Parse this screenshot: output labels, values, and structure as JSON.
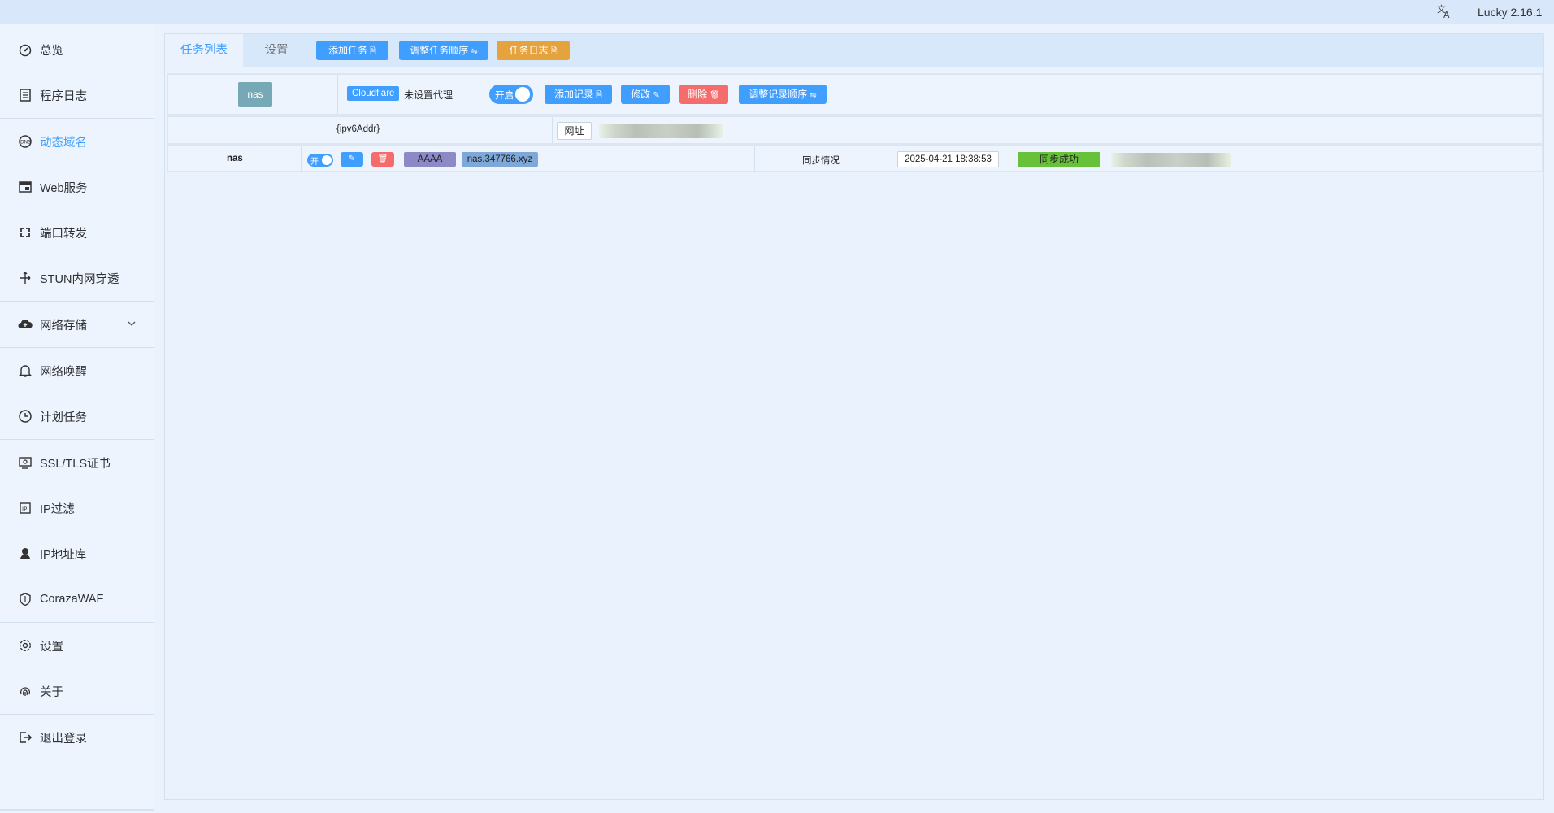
{
  "header": {
    "language_icon": "translate-icon",
    "version": "Lucky 2.16.1"
  },
  "sidebar": {
    "items": [
      {
        "label": "总览",
        "icon": "dashboard-icon"
      },
      {
        "label": "程序日志",
        "icon": "log-icon"
      },
      {
        "label": "动态域名",
        "icon": "dns-icon"
      },
      {
        "label": "Web服务",
        "icon": "web-service-icon"
      },
      {
        "label": "端口转发",
        "icon": "port-forward-icon"
      },
      {
        "label": "STUN内网穿透",
        "icon": "stun-icon"
      },
      {
        "label": "网络存储",
        "icon": "cloud-storage-icon"
      },
      {
        "label": "网络唤醒",
        "icon": "bell-icon"
      },
      {
        "label": "计划任务",
        "icon": "clock-icon"
      },
      {
        "label": "SSL/TLS证书",
        "icon": "certificate-icon"
      },
      {
        "label": "IP过滤",
        "icon": "filter-icon"
      },
      {
        "label": "IP地址库",
        "icon": "ip-database-icon"
      },
      {
        "label": "CorazaWAF",
        "icon": "shield-icon"
      },
      {
        "label": "设置",
        "icon": "gear-icon"
      },
      {
        "label": "关于",
        "icon": "fingerprint-icon"
      },
      {
        "label": "退出登录",
        "icon": "logout-icon"
      }
    ],
    "active": "动态域名",
    "accent": "#409eff"
  },
  "toolbar": {
    "tab_task_list": "任务列表",
    "tab_settings": "设置",
    "add_task": "添加任务",
    "reorder_tasks": "调整任务顺序",
    "task_log": "任务日志"
  },
  "task": {
    "name": "nas",
    "provider": "Cloudflare",
    "proxy": "未设置代理",
    "switch_label": "开启",
    "add_record": "添加记录",
    "edit": "修改",
    "delete": "删除",
    "reorder_records": "调整记录顺序",
    "ip_source": "{ipv6Addr}",
    "url_label": "网址"
  },
  "record": {
    "name": "nas",
    "switch_label": "开",
    "type": "AAAA",
    "domain": "nas.347766.xyz",
    "sync_label": "同步情况",
    "sync_time": "2025-04-21 18:38:53",
    "sync_status": "同步成功"
  },
  "colors": {
    "blue": "#409eff",
    "orange": "#e6a23c",
    "red": "#f56c6c",
    "green": "#67c23a",
    "purple": "#8c89c6"
  }
}
